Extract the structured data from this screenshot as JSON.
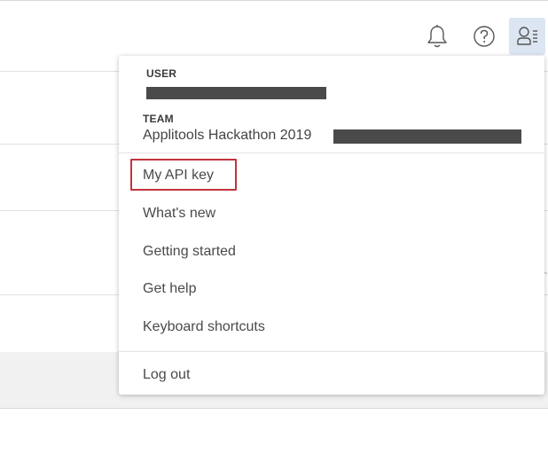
{
  "header": {
    "icons": [
      "bell-icon",
      "help-icon",
      "user-menu-icon"
    ],
    "active_icon_bg": "#dce6f2"
  },
  "user_menu": {
    "user_label": "USER",
    "team_label": "TEAM",
    "team_name": "Applitools Hackathon 2019",
    "items": [
      {
        "label": "My API key",
        "highlighted": true
      },
      {
        "label": "What's new"
      },
      {
        "label": "Getting started"
      },
      {
        "label": "Get help"
      },
      {
        "label": "Keyboard shortcuts"
      }
    ],
    "logout_label": "Log out",
    "highlight_color": "#c0343b"
  }
}
